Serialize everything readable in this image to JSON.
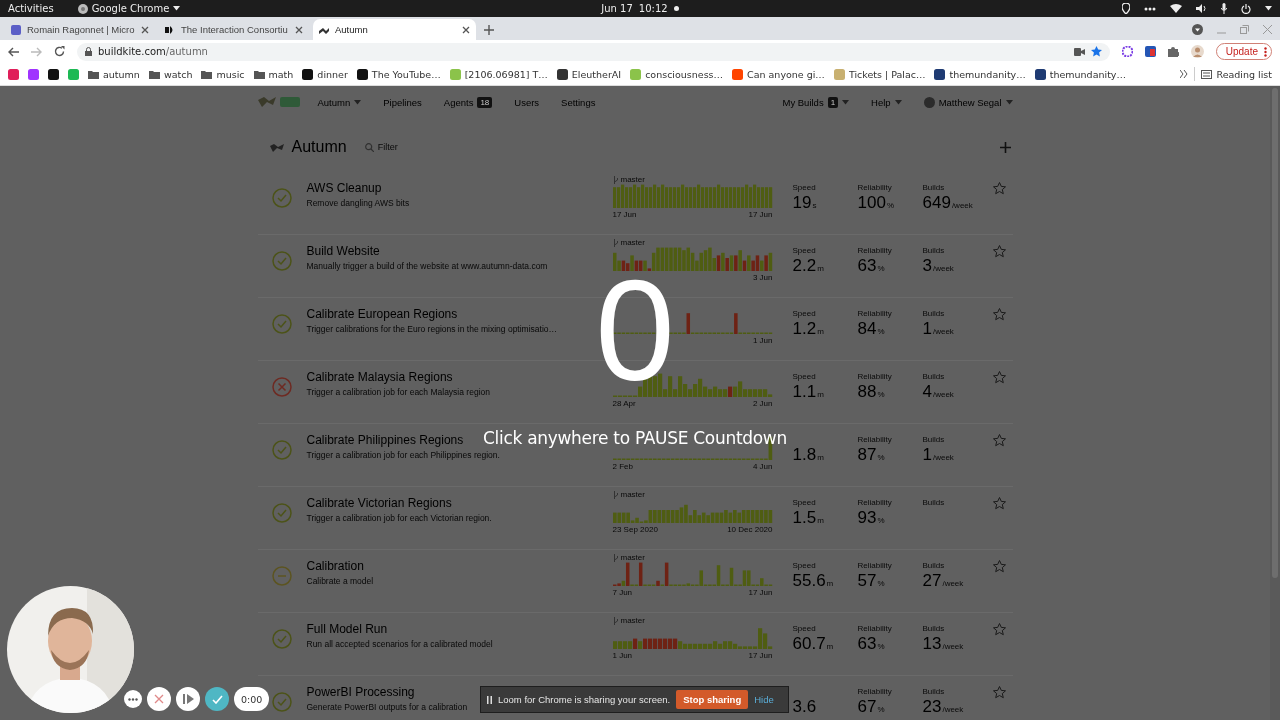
{
  "system_bar": {
    "activities": "Activities",
    "app": "Google Chrome",
    "date": "Jun 17",
    "time": "10:12"
  },
  "tabs": [
    {
      "title": "Romain Ragonnet | Micro",
      "selected": false
    },
    {
      "title": "The Interaction Consortiu",
      "selected": false
    },
    {
      "title": "Autumn",
      "selected": true
    }
  ],
  "address": {
    "domain": "buildkite.com",
    "path": "/autumn"
  },
  "update_button": "Update",
  "bookmarks": [
    {
      "kind": "site",
      "color": "#e01e5a"
    },
    {
      "kind": "site",
      "color": "#a033ff"
    },
    {
      "kind": "site",
      "color": "#111111"
    },
    {
      "kind": "site",
      "color": "#1db954"
    },
    {
      "kind": "folder",
      "label": "autumn"
    },
    {
      "kind": "folder",
      "label": "watch"
    },
    {
      "kind": "folder",
      "label": "music"
    },
    {
      "kind": "folder",
      "label": "math"
    },
    {
      "kind": "site",
      "label": "dinner",
      "color": "#111111"
    },
    {
      "kind": "site",
      "label": "The YouTube…",
      "color": "#111111"
    },
    {
      "kind": "site",
      "label": "[2106.06981] T…",
      "color": "#8bc34a"
    },
    {
      "kind": "site",
      "label": "EleutherAI",
      "color": "#333333"
    },
    {
      "kind": "site",
      "label": "consciousness…",
      "color": "#8bc34a"
    },
    {
      "kind": "site",
      "label": "Can anyone gi…",
      "color": "#ff4500"
    },
    {
      "kind": "site",
      "label": "Tickets | Palac…",
      "color": "#c8b070"
    },
    {
      "kind": "site",
      "label": "themundanity…",
      "color": "#1f3b73"
    },
    {
      "kind": "site",
      "label": "themundanity…",
      "color": "#1f3b73"
    }
  ],
  "reading_list": "Reading list",
  "nav": {
    "left": [
      {
        "label": "Autumn",
        "dropdown": true
      },
      {
        "label": "Pipelines",
        "dropdown": false
      },
      {
        "label": "Agents",
        "badge": "18",
        "dropdown": false
      },
      {
        "label": "Users",
        "dropdown": false
      },
      {
        "label": "Settings",
        "dropdown": false
      }
    ],
    "right": [
      {
        "label": "My Builds",
        "badge": "1",
        "dropdown": true
      },
      {
        "label": "Help",
        "dropdown": true
      },
      {
        "label": "Matthew Segal",
        "dropdown": true
      }
    ]
  },
  "heading": "Autumn",
  "filter": {
    "placeholder": "Filter"
  },
  "pipelines": [
    {
      "name": "AWS Cleanup",
      "description": "Remove dangling AWS bits",
      "kind": "passed",
      "chart": {
        "branch": "master",
        "start": "17 Jun",
        "end": "17 Jun"
      },
      "speed": {
        "label": "Speed",
        "value": "19",
        "unit": "s"
      },
      "reliability": {
        "label": "Reliability",
        "value": "100",
        "unit": "%"
      },
      "builds": {
        "label": "Builds",
        "value": "649",
        "unit": "/week"
      },
      "starred": false
    },
    {
      "name": "Build Website",
      "description": "Manually trigger a build of the website at www.autumn-data.com",
      "kind": "passed",
      "chart": {
        "branch": "master",
        "end": "3 Jun"
      },
      "speed": {
        "label": "Speed",
        "value": "2.2",
        "unit": "m"
      },
      "reliability": {
        "label": "Reliability",
        "value": "63",
        "unit": "%"
      },
      "builds": {
        "label": "Builds",
        "value": "3",
        "unit": "/week"
      },
      "starred": false
    },
    {
      "name": "Calibrate European Regions",
      "description": "Trigger calibrations for the Euro regions in the mixing optimisatio…",
      "kind": "passed",
      "chart": {
        "end": "1 Jun"
      },
      "speed": {
        "label": "Speed",
        "value": "1.2",
        "unit": "m"
      },
      "reliability": {
        "label": "Reliability",
        "value": "84",
        "unit": "%"
      },
      "builds": {
        "label": "Builds",
        "value": "1",
        "unit": "/week"
      },
      "starred": false
    },
    {
      "name": "Calibrate Malaysia Regions",
      "description": "Trigger a calibration job for each Malaysia region",
      "kind": "failed",
      "chart": {
        "start": "28 Apr",
        "end": "2 Jun"
      },
      "speed": {
        "label": "Speed",
        "value": "1.1",
        "unit": "m"
      },
      "reliability": {
        "label": "Reliability",
        "value": "88",
        "unit": "%"
      },
      "builds": {
        "label": "Builds",
        "value": "4",
        "unit": "/week"
      },
      "starred": false
    },
    {
      "name": "Calibrate Philippines Regions",
      "description": "Trigger a calibration job for each Philippines region.",
      "kind": "passed",
      "chart": {
        "start": "2 Feb",
        "end": "4 Jun"
      },
      "speed": {
        "value": "1.8",
        "unit": "m"
      },
      "reliability": {
        "label": "Reliability",
        "value": "87",
        "unit": "%"
      },
      "builds": {
        "label": "Builds",
        "value": "1",
        "unit": "/week"
      },
      "starred": false
    },
    {
      "name": "Calibrate Victorian Regions",
      "description": "Trigger a calibration job for each Victorian region.",
      "kind": "passed",
      "chart": {
        "branch": "master",
        "start": "23 Sep 2020",
        "end": "10 Dec 2020"
      },
      "speed": {
        "label": "Speed",
        "value": "1.5",
        "unit": "m"
      },
      "reliability": {
        "label": "Reliability",
        "value": "93",
        "unit": "%"
      },
      "builds": {
        "label": "Builds"
      },
      "starred": false
    },
    {
      "name": "Calibration",
      "description": "Calibrate a model",
      "kind": "running",
      "chart": {
        "branch": "master",
        "start": "7 Jun",
        "end": "17 Jun"
      },
      "speed": {
        "label": "Speed",
        "value": "55.6",
        "unit": "m"
      },
      "reliability": {
        "label": "Reliability",
        "value": "57",
        "unit": "%"
      },
      "builds": {
        "label": "Builds",
        "value": "27",
        "unit": "/week"
      },
      "starred": false
    },
    {
      "name": "Full Model Run",
      "description": "Run all accepted scenarios for a calibrated model",
      "kind": "passed",
      "chart": {
        "branch": "master",
        "start": "1 Jun",
        "end": "17 Jun"
      },
      "speed": {
        "label": "Speed",
        "value": "60.7",
        "unit": "m"
      },
      "reliability": {
        "label": "Reliability",
        "value": "63",
        "unit": "%"
      },
      "builds": {
        "label": "Builds",
        "value": "13",
        "unit": "/week"
      },
      "starred": false
    },
    {
      "name": "PowerBI Processing",
      "description": "Generate PowerBI outputs for a calibration",
      "kind": "passed",
      "speed": {
        "value": "3.6"
      },
      "reliability": {
        "label": "Reliability",
        "value": "67",
        "unit": "%"
      },
      "builds": {
        "label": "Builds",
        "value": "23",
        "unit": "/week"
      },
      "starred": false
    }
  ],
  "countdown": {
    "number": "0",
    "message": "Click anywhere to PAUSE Countdown"
  },
  "loom_banner": {
    "message": "Loom for Chrome is sharing your screen.",
    "stop": "Stop sharing",
    "hide": "Hide"
  },
  "recorder": {
    "timer": "0:00"
  }
}
